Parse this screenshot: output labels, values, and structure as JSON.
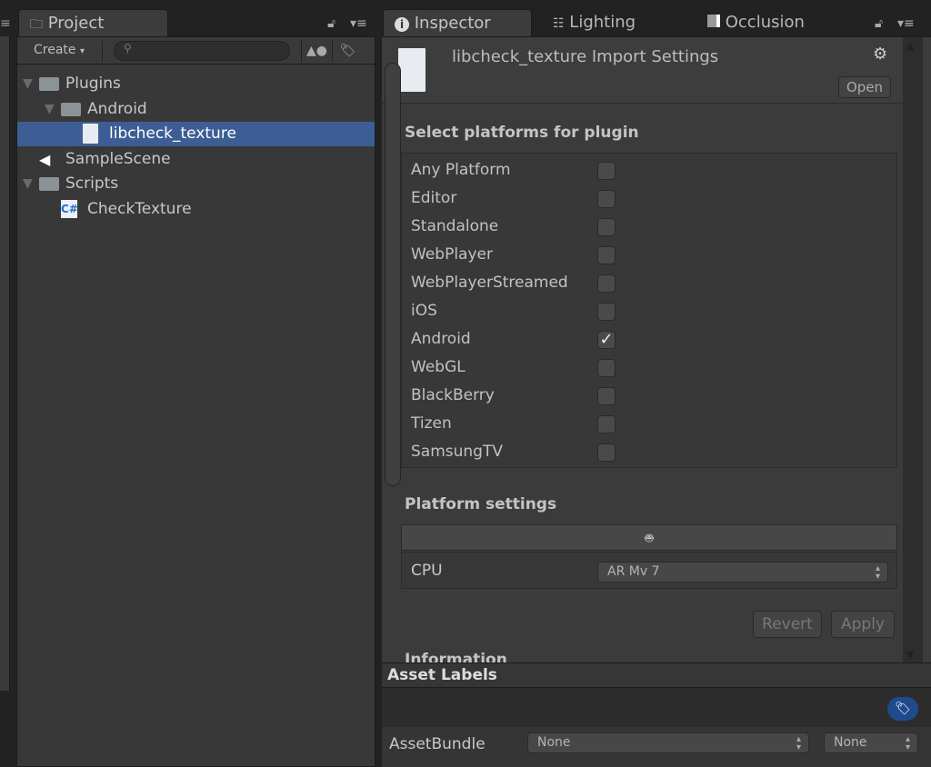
{
  "project": {
    "tab": "Project",
    "create": "Create",
    "create_arrow": "▾",
    "tree": [
      {
        "label": "Plugins",
        "indent": 0,
        "icon": "folder",
        "expanded": true
      },
      {
        "label": "Android",
        "indent": 1,
        "icon": "folder",
        "expanded": true
      },
      {
        "label": "libcheck_texture",
        "indent": 2,
        "icon": "file",
        "selected": true
      },
      {
        "label": "SampleScene",
        "indent": 0,
        "icon": "unity-scene"
      },
      {
        "label": "Scripts",
        "indent": 0,
        "icon": "folder",
        "expanded": true
      },
      {
        "label": "CheckTexture",
        "indent": 1,
        "icon": "csharp-script"
      }
    ]
  },
  "inspector": {
    "tabs": [
      "Inspector",
      "Lighting",
      "Occlusion"
    ],
    "title": "libcheck_texture Import Settings",
    "open": "Open",
    "select_heading": "Select platforms for plugin",
    "platforms": [
      {
        "name": "Any Platform",
        "checked": false
      },
      {
        "name": "Editor",
        "checked": false
      },
      {
        "name": "Standalone",
        "checked": false
      },
      {
        "name": "WebPlayer",
        "checked": false
      },
      {
        "name": "WebPlayerStreamed",
        "checked": false
      },
      {
        "name": "iOS",
        "checked": false
      },
      {
        "name": "Android",
        "checked": true
      },
      {
        "name": "WebGL",
        "checked": false
      },
      {
        "name": "BlackBerry",
        "checked": false
      },
      {
        "name": "Tizen",
        "checked": false
      },
      {
        "name": "SamsungTV",
        "checked": false
      }
    ],
    "platform_settings": "Platform settings",
    "cpu_label": "CPU",
    "cpu_value": "AR Mv 7",
    "revert": "Revert",
    "apply": "Apply",
    "information": "Information"
  },
  "asset_labels": {
    "title": "Asset Labels",
    "bundle_label": "AssetBundle",
    "bundle_value": "None",
    "variant_value": "None"
  },
  "colors": {
    "selection": "#3c5e95",
    "tag_button": "#1f4a8c"
  }
}
